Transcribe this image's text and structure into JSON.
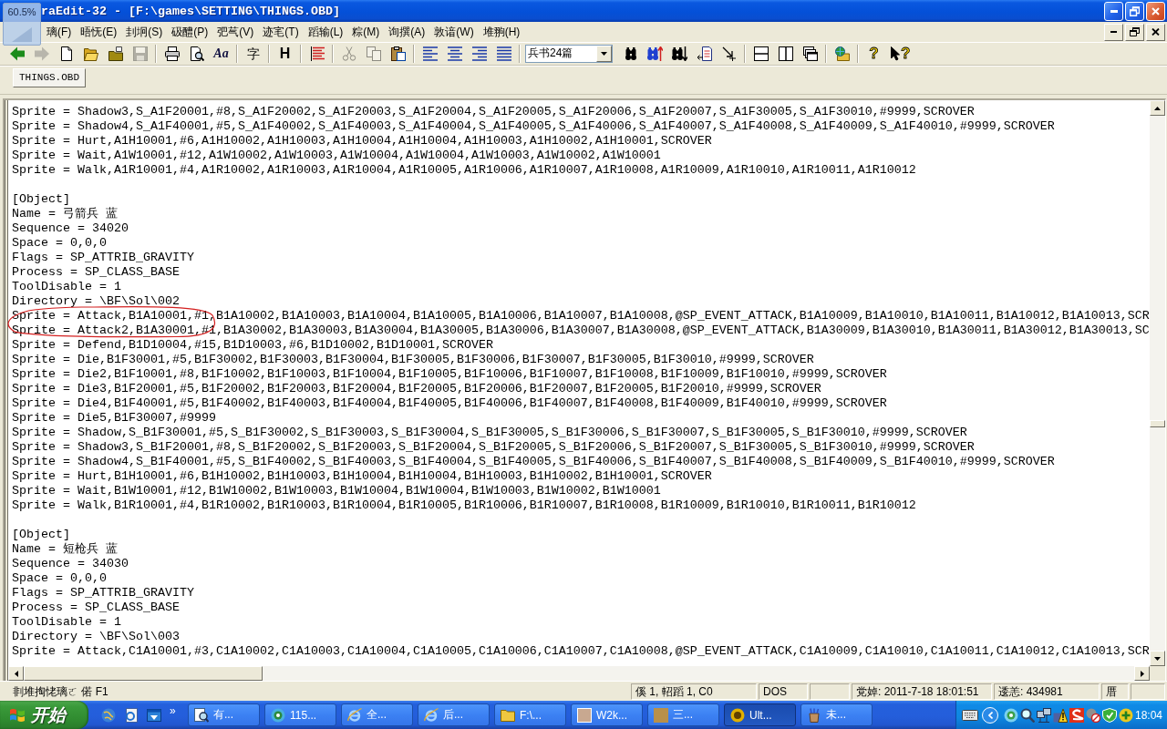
{
  "overlay": {
    "reading": "60.5%"
  },
  "window": {
    "title": "raEdit-32 - [F:\\games\\SETTING\\THINGS.OBD]"
  },
  "menu": [
    "璃(F)",
    "晤怃(E)",
    "刲坰(S)",
    "砐醴(P)",
    "弝芞(V)",
    "迹宒(T)",
    "蹈输(L)",
    "粽(M)",
    "询撰(A)",
    "敦谙(W)",
    "堆翑(H)"
  ],
  "toolbar": {
    "groups": [
      [
        {
          "kind": "back",
          "disabled": false
        },
        {
          "kind": "forward",
          "disabled": true
        },
        {
          "kind": "new",
          "disabled": false
        },
        {
          "kind": "open",
          "disabled": false
        },
        {
          "kind": "folder",
          "disabled": false
        },
        {
          "kind": "save",
          "disabled": true
        }
      ],
      [
        {
          "kind": "print",
          "disabled": false
        },
        {
          "kind": "preview",
          "disabled": false
        },
        {
          "kind": "font",
          "label": "Aa",
          "disabled": false
        }
      ],
      [
        {
          "kind": "charset",
          "label": "字",
          "disabled": false
        }
      ],
      [
        {
          "kind": "heading",
          "label": "H",
          "disabled": false
        }
      ],
      [
        {
          "kind": "lines",
          "disabled": false
        }
      ],
      [
        {
          "kind": "cut",
          "disabled": true
        },
        {
          "kind": "copy",
          "disabled": true
        },
        {
          "kind": "paste",
          "disabled": false
        }
      ],
      [
        {
          "kind": "left",
          "disabled": false
        },
        {
          "kind": "center",
          "disabled": false
        },
        {
          "kind": "right",
          "disabled": false
        },
        {
          "kind": "justify",
          "disabled": false
        }
      ],
      [
        {
          "kind": "combo",
          "value": "兵书24篇",
          "disabled": false
        },
        {
          "kind": "find",
          "disabled": false
        },
        {
          "kind": "findup",
          "disabled": false
        },
        {
          "kind": "finddown",
          "disabled": false
        },
        {
          "kind": "replace",
          "disabled": false
        },
        {
          "kind": "goto",
          "disabled": false
        }
      ],
      [
        {
          "kind": "splith",
          "disabled": false
        },
        {
          "kind": "splitv",
          "disabled": false
        },
        {
          "kind": "cascade",
          "disabled": false
        }
      ],
      [
        {
          "kind": "project",
          "disabled": false
        }
      ],
      [
        {
          "kind": "help",
          "label": "?",
          "disabled": false
        },
        {
          "kind": "whatsthis",
          "label": "?",
          "disabled": false
        }
      ]
    ]
  },
  "tabs": [
    {
      "label": "THINGS.OBD",
      "selected": true
    }
  ],
  "editor": {
    "sections": [
      {
        "lines": [
          {
            "text": "Sprite = Shadow3,S_A1F20001,#8,S_A1F20002,S_A1F20003,S_A1F20004,S_A1F20005,S_A1F20006,S_A1F20007,S_A1F30005,S_A1F30010,#9999,SCROVER",
            "circled": false
          },
          {
            "text": "Sprite = Shadow4,S_A1F40001,#5,S_A1F40002,S_A1F40003,S_A1F40004,S_A1F40005,S_A1F40006,S_A1F40007,S_A1F40008,S_A1F40009,S_A1F40010,#9999,SCROVER",
            "circled": false
          },
          {
            "text": "Sprite = Hurt,A1H10001,#6,A1H10002,A1H10003,A1H10004,A1H10004,A1H10003,A1H10002,A1H10001,SCROVER",
            "circled": false
          },
          {
            "text": "Sprite = Wait,A1W10001,#12,A1W10002,A1W10003,A1W10004,A1W10004,A1W10003,A1W10002,A1W10001",
            "circled": false
          },
          {
            "text": "Sprite = Walk,A1R10001,#4,A1R10002,A1R10003,A1R10004,A1R10005,A1R10006,A1R10007,A1R10008,A1R10009,A1R10010,A1R10011,A1R10012",
            "circled": false
          }
        ]
      },
      {
        "lines": [
          {
            "text": "[Object]",
            "circled": false
          },
          {
            "text": "Name = 弓箭兵 蓝",
            "circled": false
          },
          {
            "text": "Sequence = 34020",
            "circled": false
          },
          {
            "text": "Space = 0,0,0",
            "circled": false
          },
          {
            "text": "Flags = SP_ATTRIB_GRAVITY",
            "circled": false
          },
          {
            "text": "Process = SP_CLASS_BASE",
            "circled": false
          },
          {
            "text": "ToolDisable = 1",
            "circled": false
          },
          {
            "text": "Directory = \\BF\\Sol\\002",
            "circled": false
          },
          {
            "text": "Sprite = Attack,B1A10001,#1,B1A10002,B1A10003,B1A10004,B1A10005,B1A10006,B1A10007,B1A10008,@SP_EVENT_ATTACK,B1A10009,B1A10010,B1A10011,B1A10012,B1A10013,SCR",
            "circled": true
          },
          {
            "text": "Sprite = Attack2,B1A30001,#1,B1A30002,B1A30003,B1A30004,B1A30005,B1A30006,B1A30007,B1A30008,@SP_EVENT_ATTACK,B1A30009,B1A30010,B1A30011,B1A30012,B1A30013,SC",
            "circled": true
          },
          {
            "text": "Sprite = Defend,B1D10004,#15,B1D10003,#6,B1D10002,B1D10001,SCROVER",
            "circled": false
          },
          {
            "text": "Sprite = Die,B1F30001,#5,B1F30002,B1F30003,B1F30004,B1F30005,B1F30006,B1F30007,B1F30005,B1F30010,#9999,SCROVER",
            "circled": false
          },
          {
            "text": "Sprite = Die2,B1F10001,#8,B1F10002,B1F10003,B1F10004,B1F10005,B1F10006,B1F10007,B1F10008,B1F10009,B1F10010,#9999,SCROVER",
            "circled": false
          },
          {
            "text": "Sprite = Die3,B1F20001,#5,B1F20002,B1F20003,B1F20004,B1F20005,B1F20006,B1F20007,B1F20005,B1F20010,#9999,SCROVER",
            "circled": false
          },
          {
            "text": "Sprite = Die4,B1F40001,#5,B1F40002,B1F40003,B1F40004,B1F40005,B1F40006,B1F40007,B1F40008,B1F40009,B1F40010,#9999,SCROVER",
            "circled": false
          },
          {
            "text": "Sprite = Die5,B1F30007,#9999",
            "circled": false
          },
          {
            "text": "Sprite = Shadow,S_B1F30001,#5,S_B1F30002,S_B1F30003,S_B1F30004,S_B1F30005,S_B1F30006,S_B1F30007,S_B1F30005,S_B1F30010,#9999,SCROVER",
            "circled": false
          },
          {
            "text": "Sprite = Shadow3,S_B1F20001,#8,S_B1F20002,S_B1F20003,S_B1F20004,S_B1F20005,S_B1F20006,S_B1F20007,S_B1F30005,S_B1F30010,#9999,SCROVER",
            "circled": false
          },
          {
            "text": "Sprite = Shadow4,S_B1F40001,#5,S_B1F40002,S_B1F40003,S_B1F40004,S_B1F40005,S_B1F40006,S_B1F40007,S_B1F40008,S_B1F40009,S_B1F40010,#9999,SCROVER",
            "circled": false
          },
          {
            "text": "Sprite = Hurt,B1H10001,#6,B1H10002,B1H10003,B1H10004,B1H10004,B1H10003,B1H10002,B1H10001,SCROVER",
            "circled": false
          },
          {
            "text": "Sprite = Wait,B1W10001,#12,B1W10002,B1W10003,B1W10004,B1W10004,B1W10003,B1W10002,B1W10001",
            "circled": false
          },
          {
            "text": "Sprite = Walk,B1R10001,#4,B1R10002,B1R10003,B1R10004,B1R10005,B1R10006,B1R10007,B1R10008,B1R10009,B1R10010,B1R10011,B1R10012",
            "circled": false
          }
        ]
      },
      {
        "lines": [
          {
            "text": "[Object]",
            "circled": false
          },
          {
            "text": "Name = 短枪兵 蓝",
            "circled": false
          },
          {
            "text": "Sequence = 34030",
            "circled": false
          },
          {
            "text": "Space = 0,0,0",
            "circled": false
          },
          {
            "text": "Flags = SP_ATTRIB_GRAVITY",
            "circled": false
          },
          {
            "text": "Process = SP_CLASS_BASE",
            "circled": false
          },
          {
            "text": "ToolDisable = 1",
            "circled": false
          },
          {
            "text": "Directory = \\BF\\Sol\\003",
            "circled": false
          },
          {
            "text": "Sprite = Attack,C1A10001,#3,C1A10002,C1A10003,C1A10004,C1A10005,C1A10006,C1A10007,C1A10008,@SP_EVENT_ATTACK,C1A10009,C1A10010,C1A10011,C1A10012,C1A10013,SCR",
            "circled": false
          }
        ]
      }
    ]
  },
  "status_bar": {
    "hint": "剕堆掏恅璃ㄛ 偌 F1",
    "panels": [
      {
        "kind": "text",
        "text": "傒 1, 軺蹈 1, C0"
      },
      {
        "kind": "text",
        "text": "DOS"
      },
      {
        "kind": "blank"
      },
      {
        "kind": "text",
        "text": "党婥: 2011-7-18 18:01:51"
      },
      {
        "kind": "text",
        "text": "逶恙: 434981"
      },
      {
        "kind": "text",
        "text": "厝"
      },
      {
        "kind": "blank"
      }
    ]
  },
  "taskbar": {
    "start": "开始",
    "quick_launch_more": "»",
    "tasks": [
      {
        "kind": "search",
        "label": "有...",
        "selected": false
      },
      {
        "kind": "chat",
        "label": "115...",
        "selected": false
      },
      {
        "kind": "browser",
        "label": "全...",
        "selected": false
      },
      {
        "kind": "browser",
        "label": "后...",
        "selected": false
      },
      {
        "kind": "folder",
        "label": "F:\\...",
        "selected": false
      },
      {
        "kind": "photo",
        "label": "W2k...",
        "selected": false
      },
      {
        "kind": "picture",
        "label": "三...",
        "selected": false
      },
      {
        "kind": "editor",
        "label": "Ult...",
        "selected": true
      },
      {
        "kind": "app",
        "label": "未...",
        "selected": false
      }
    ],
    "clock": "18:04"
  }
}
